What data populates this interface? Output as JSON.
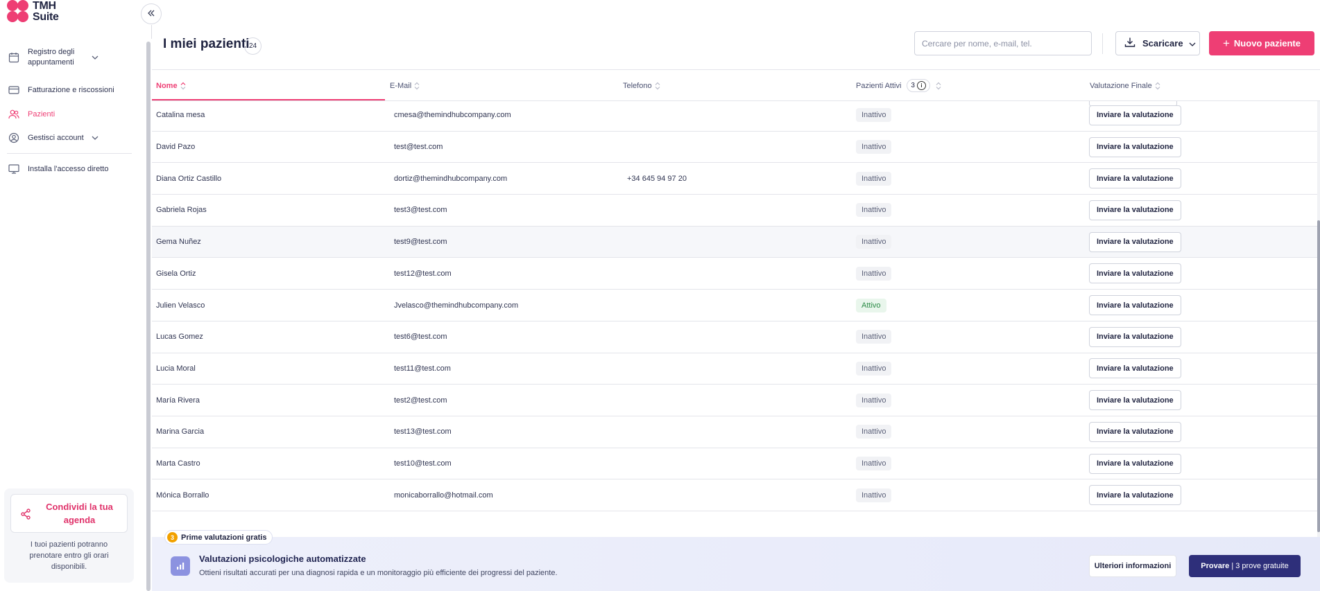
{
  "brand": {
    "line1": "TMH",
    "line2": "Suite",
    "accent": "#ee3e74"
  },
  "sidebar": {
    "items": [
      {
        "label": "Registro degli appuntamenti",
        "icon": "calendar-icon"
      },
      {
        "label": "Fatturazione e riscossioni",
        "icon": "credit-card-icon"
      },
      {
        "label": "Pazienti",
        "icon": "users-icon"
      },
      {
        "label": "Gestisci account",
        "icon": "user-circle-icon"
      },
      {
        "label": "Installa l'accesso diretto",
        "icon": "monitor-icon"
      }
    ],
    "share": {
      "label": "Condividi la tua agenda",
      "description": "I tuoi pazienti potranno prenotare entro gli orari disponibili."
    }
  },
  "header": {
    "title": "I miei pazienti",
    "count": "24",
    "search_placeholder": "Cercare per nome, e-mail, tel.",
    "download_label": "Scaricare",
    "new_label": "Nuovo paziente"
  },
  "table": {
    "columns": {
      "name": "Nome",
      "email": "E-Mail",
      "phone": "Telefono",
      "active": "Pazienti Attivi",
      "active_count": "3",
      "final": "Valutazione Finale"
    },
    "send_label": "Inviare la valutazione",
    "rows": [
      {
        "name": "Catalina mesa",
        "email": "cmesa@themindhubcompany.com",
        "phone": "",
        "status": "Inattivo"
      },
      {
        "name": "David Pazo",
        "email": "test@test.com",
        "phone": "",
        "status": "Inattivo"
      },
      {
        "name": "Diana Ortiz Castillo",
        "email": "dortiz@themindhubcompany.com",
        "phone": "+34 645 94 97 20",
        "status": "Inattivo"
      },
      {
        "name": "Gabriela Rojas",
        "email": "test3@test.com",
        "phone": "",
        "status": "Inattivo"
      },
      {
        "name": "Gema Nuñez",
        "email": "test9@test.com",
        "phone": "",
        "status": "Inattivo"
      },
      {
        "name": "Gisela Ortiz",
        "email": "test12@test.com",
        "phone": "",
        "status": "Inattivo"
      },
      {
        "name": "Julien Velasco",
        "email": "Jvelasco@themindhubcompany.com",
        "phone": "",
        "status": "Attivo"
      },
      {
        "name": "Lucas Gomez",
        "email": "test6@test.com",
        "phone": "",
        "status": "Inattivo"
      },
      {
        "name": "Lucia Moral",
        "email": "test11@test.com",
        "phone": "",
        "status": "Inattivo"
      },
      {
        "name": "María Rivera",
        "email": "test2@test.com",
        "phone": "",
        "status": "Inattivo"
      },
      {
        "name": "Marina Garcia",
        "email": "test13@test.com",
        "phone": "",
        "status": "Inattivo"
      },
      {
        "name": "Marta Castro",
        "email": "test10@test.com",
        "phone": "",
        "status": "Inattivo"
      },
      {
        "name": "Mónica Borrallo",
        "email": "monicaborrallo@hotmail.com",
        "phone": "",
        "status": "Inattivo"
      }
    ]
  },
  "promo": {
    "tag_count": "3",
    "tag_label": "Prime valutazioni gratis",
    "title": "Valutazioni psicologiche automatizzate",
    "description": "Ottieni risultati accurati per una diagnosi rapida e un monitoraggio più efficiente dei progressi del paziente.",
    "more_label": "Ulteriori informazioni",
    "try_label": "Provare",
    "try_suffix": " | 3 prove gratuite",
    "button_color": "#2e2f7a"
  }
}
